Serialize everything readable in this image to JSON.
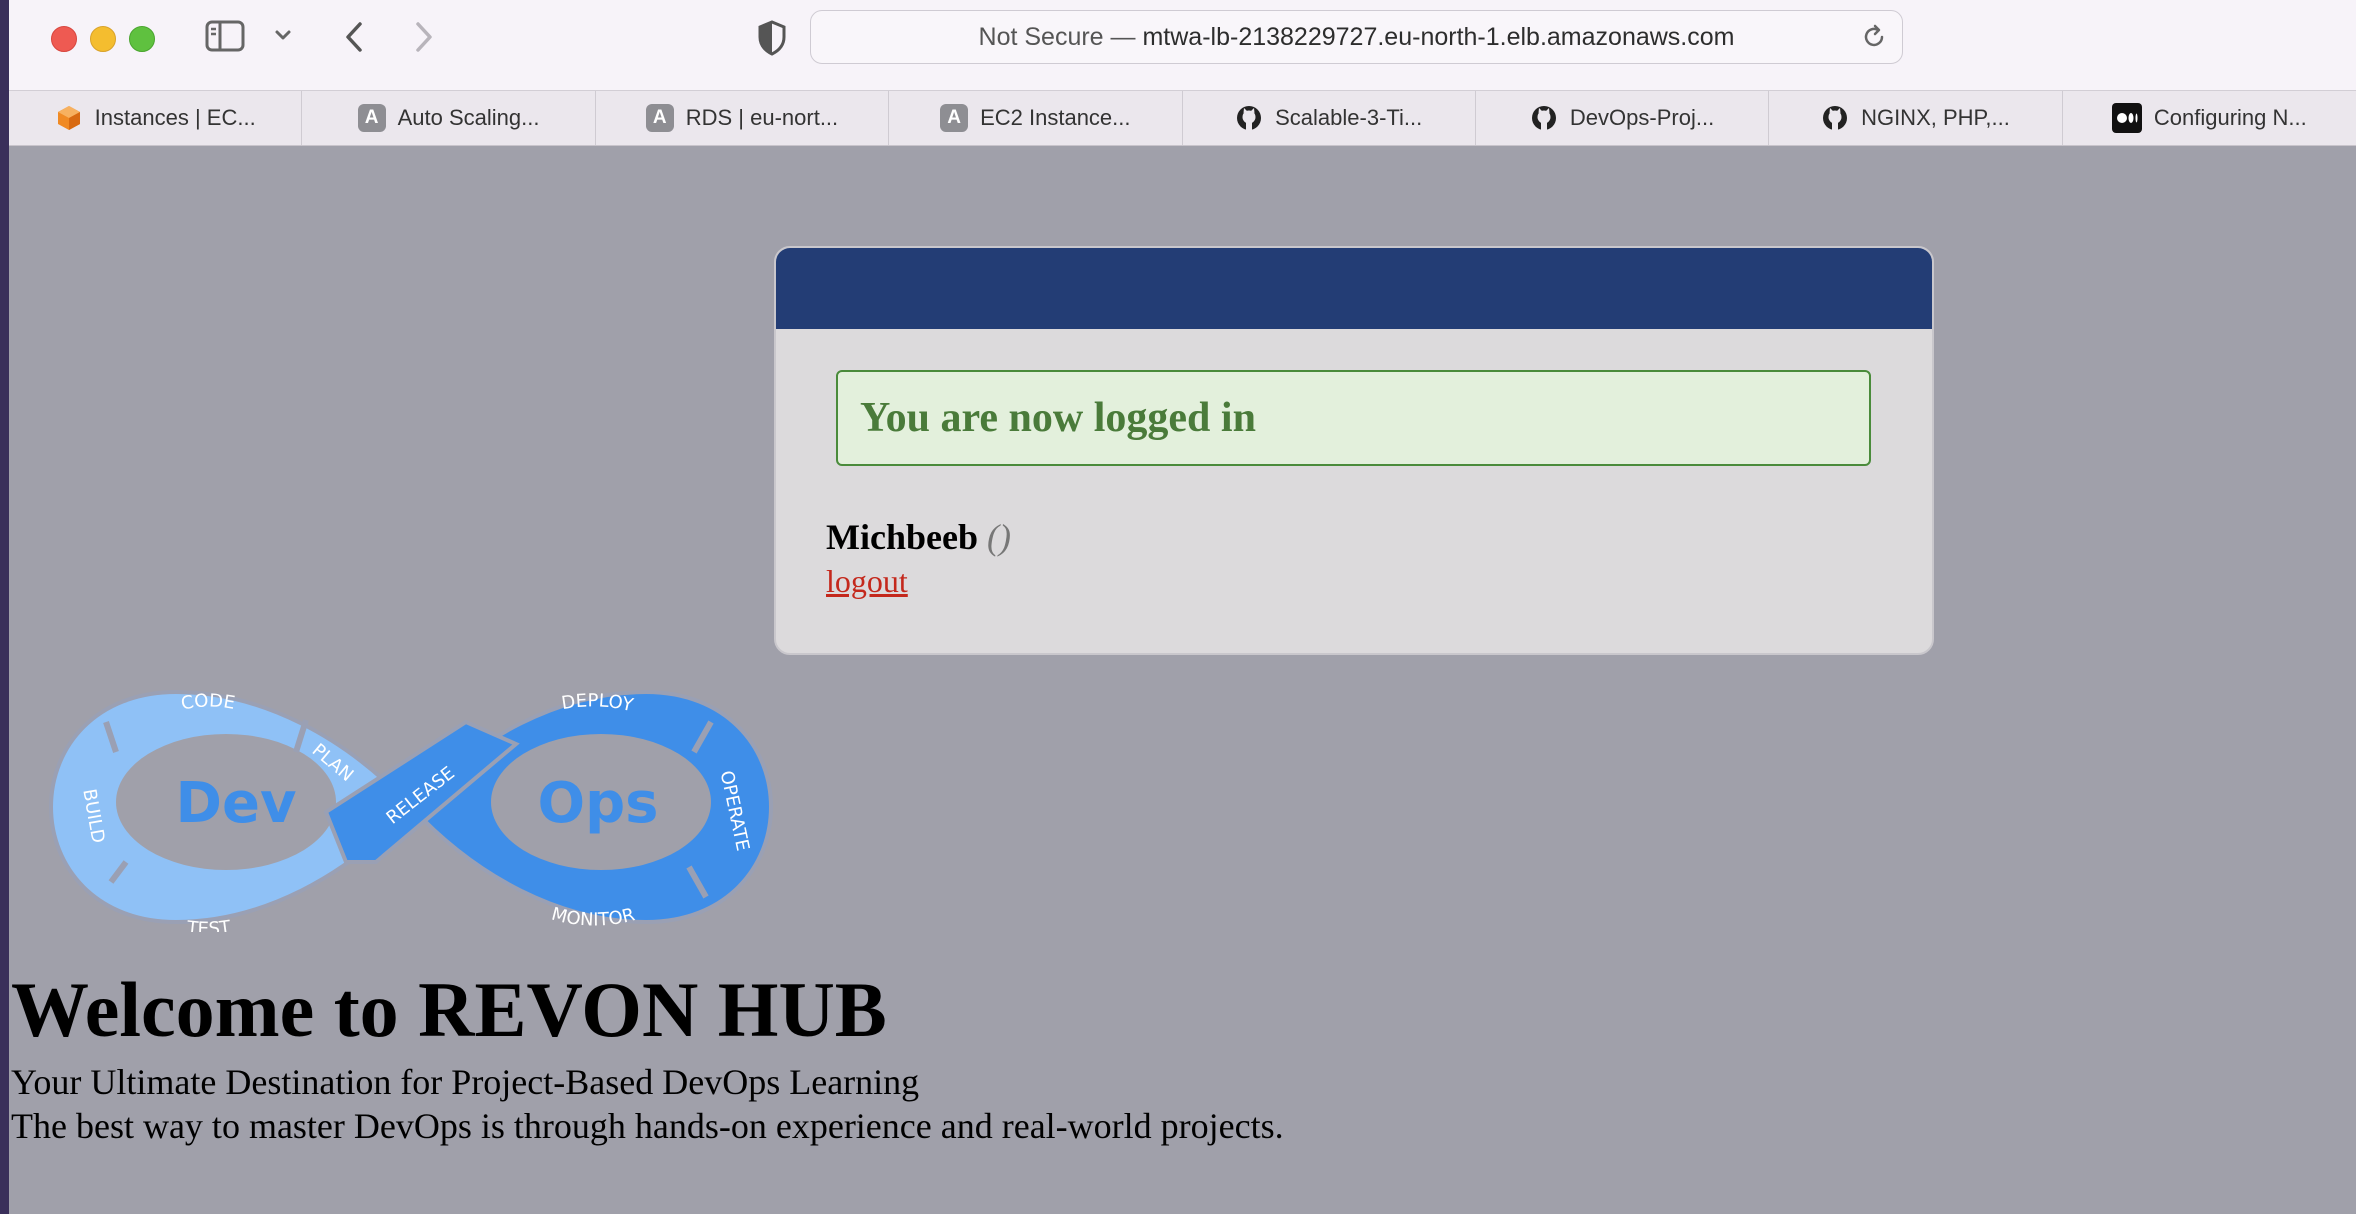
{
  "browser": {
    "url_prefix": "Not Secure —",
    "url_host": "mtwa-lb-2138229727.eu-north-1.elb.amazonaws.com",
    "tabs": [
      {
        "label": "Instances | EC...",
        "icon": "aws-ec2-icon"
      },
      {
        "label": "Auto Scaling...",
        "icon": "a-icon",
        "glyph": "A"
      },
      {
        "label": "RDS | eu-nort...",
        "icon": "a-icon",
        "glyph": "A"
      },
      {
        "label": "EC2 Instance...",
        "icon": "a-icon",
        "glyph": "A"
      },
      {
        "label": "Scalable-3-Ti...",
        "icon": "github-icon"
      },
      {
        "label": "DevOps-Proj...",
        "icon": "github-icon"
      },
      {
        "label": "NGINX, PHP,...",
        "icon": "github-icon"
      },
      {
        "label": "Configuring N...",
        "icon": "medium-icon"
      }
    ]
  },
  "login": {
    "message": "You are now logged in",
    "username": "Michbeeb",
    "role": "()",
    "logout": "logout"
  },
  "logo": {
    "dev": "Dev",
    "ops": "Ops",
    "stages": [
      "CODE",
      "PLAN",
      "BUILD",
      "TEST",
      "RELEASE",
      "DEPLOY",
      "OPERATE",
      "MONITOR"
    ]
  },
  "hero": {
    "title": "Welcome to REVON HUB",
    "subtitle": "Your Ultimate Destination for Project-Based DevOps Learning",
    "tagline": "The best way to master DevOps is through hands-on experience and real-world projects."
  },
  "colors": {
    "header_bar": "#233d75",
    "success_text": "#4a7b3a",
    "logout_link": "#c4281c",
    "page_bg": "#a0a0aa",
    "logo_light": "#8fc1f6",
    "logo_dark": "#3f8ee8"
  }
}
